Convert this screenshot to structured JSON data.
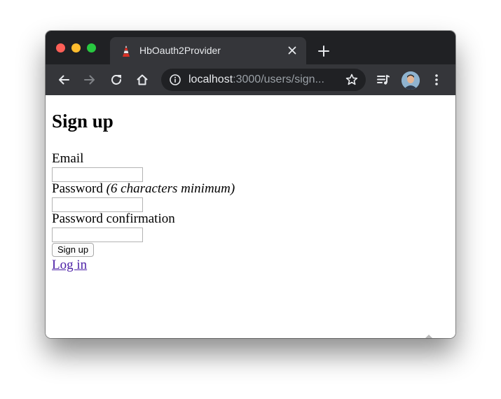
{
  "browser": {
    "tab": {
      "title": "HbOauth2Provider",
      "favicon": "tower-icon"
    },
    "address_bar": {
      "host": "localhost",
      "path": ":3000/users/sign..."
    },
    "icons": {
      "back": "arrow-left-icon",
      "forward": "arrow-right-icon",
      "reload": "reload-icon",
      "home": "home-icon",
      "info": "info-icon",
      "bookmark": "star-icon",
      "media": "playlist-icon",
      "menu": "kebab-menu-icon",
      "new_tab": "plus-icon",
      "close_tab": "close-icon"
    },
    "colors": {
      "frame": "#202124",
      "toolbar": "#35363a",
      "omnibox": "#202124"
    }
  },
  "page": {
    "title": "Sign up",
    "form": {
      "email_label": "Email",
      "password_label": "Password",
      "password_hint": "(6 characters minimum)",
      "password_confirmation_label": "Password confirmation",
      "email_value": "",
      "password_value": "",
      "password_confirmation_value": "",
      "submit_label": "Sign up"
    },
    "links": {
      "login": "Log in"
    },
    "link_color": "#4b1fa6"
  }
}
